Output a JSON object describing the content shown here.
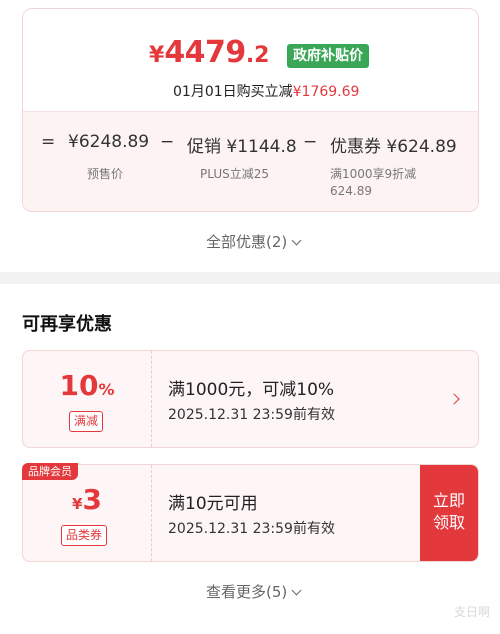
{
  "price": {
    "currency": "¥",
    "final_int": "4479",
    "final_dec": ".2",
    "gov_badge": "政府补贴价",
    "date_text": "01月01日购买立减",
    "reduce_amount": "¥1769.69"
  },
  "breakdown": {
    "eq": "=",
    "presale_value": "¥6248.89",
    "presale_label": "预售价",
    "minus1": "−",
    "promo_name": "促销",
    "promo_value": "¥1144.8",
    "promo_sub": "PLUS立减25",
    "minus2": "−",
    "coupon_name": "优惠券",
    "coupon_value": "¥624.89",
    "coupon_sub_line1": "满1000享9折减",
    "coupon_sub_line2": "624.89"
  },
  "all_discounts_label": "全部优惠(2)",
  "section_title": "可再享优惠",
  "coupons": [
    {
      "value_num": "10",
      "value_unit": "%",
      "tag": "满减",
      "title": "满1000元，可减10%",
      "date": "2025.12.31 23:59前有效"
    },
    {
      "badge": "品牌会员",
      "value_prefix": "¥",
      "value_num": "3",
      "tag": "品类券",
      "title": "满10元可用",
      "date": "2025.12.31 23:59前有效",
      "button_line1": "立即",
      "button_line2": "领取"
    }
  ],
  "see_more_label": "查看更多(5)",
  "watermark": "支日啊",
  "colors": {
    "accent": "#e4393c",
    "gov_badge": "#3aa757"
  }
}
